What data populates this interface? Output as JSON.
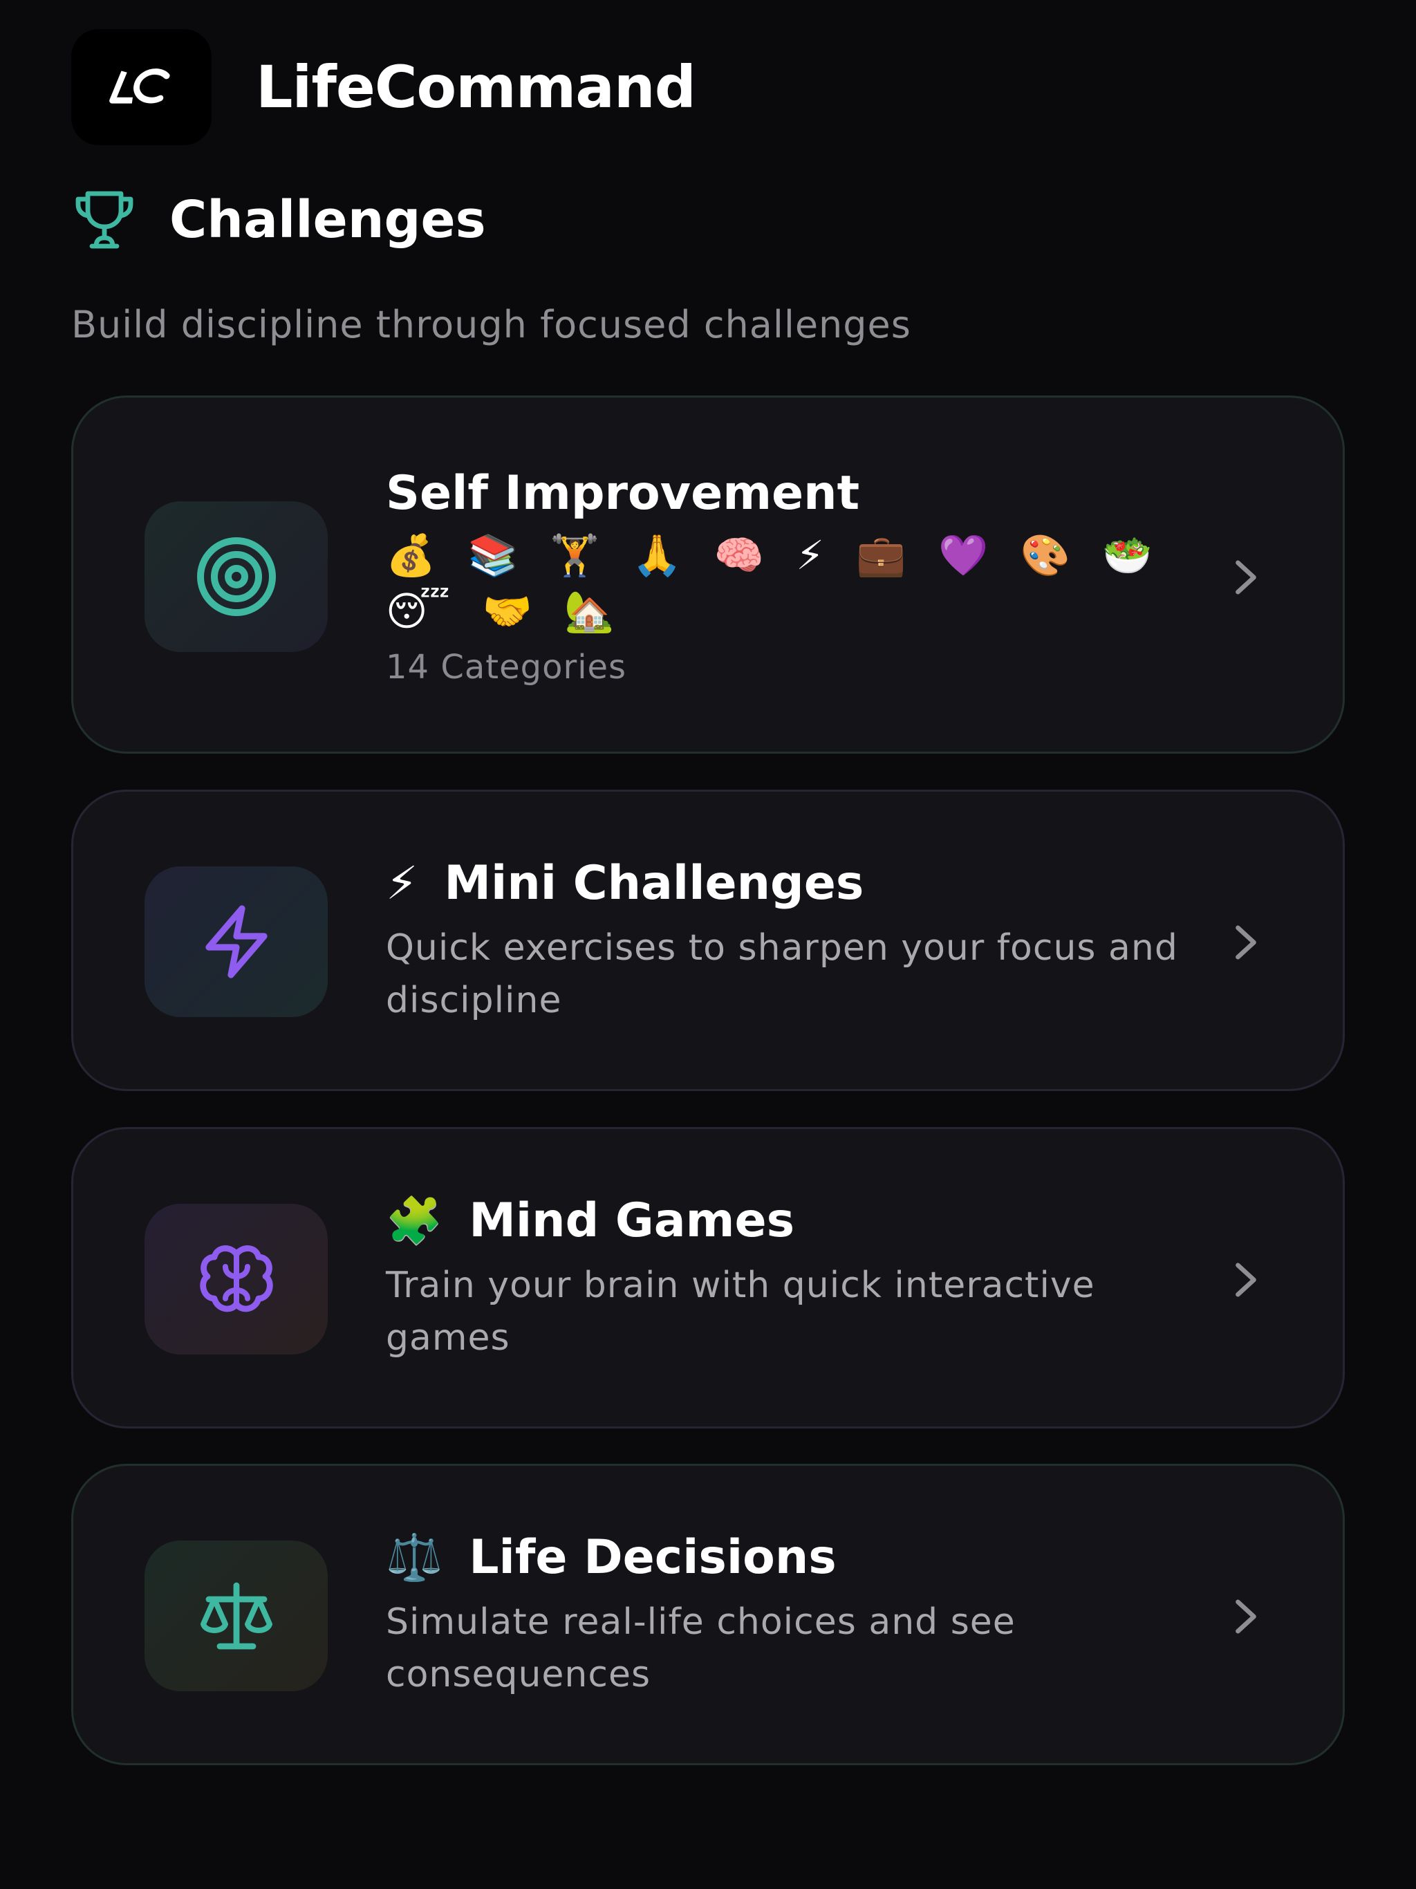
{
  "app": {
    "logo_text": "LC",
    "title": "LifeCommand"
  },
  "section": {
    "icon": "trophy-icon",
    "title": "Challenges",
    "subtitle": "Build discipline through focused challenges"
  },
  "cards": [
    {
      "icon": "target-icon",
      "title": "Self Improvement",
      "emoji_row_1": "💰 📚 🏋️ 🙏 🧠 ⚡ 💼 💜 🎨 🥗",
      "emoji_row_2": "😴 🤝 🏡",
      "meta": "14 Categories"
    },
    {
      "icon": "lightning-icon",
      "title_emoji": "⚡",
      "title": "Mini Challenges",
      "description": "Quick exercises to sharpen your focus and discipline"
    },
    {
      "icon": "brain-icon",
      "title_emoji": "🧩",
      "title": "Mind Games",
      "description": "Train your brain with quick interactive games"
    },
    {
      "icon": "scale-icon",
      "title_emoji": "⚖️",
      "title": "Life Decisions",
      "description": "Simulate real-life choices and see consequences"
    }
  ],
  "colors": {
    "background": "#0a0a0c",
    "card": "#141418",
    "teal_accent": "#3fb8a2",
    "purple_accent": "#8f5cf0",
    "muted_text": "#8e8e93"
  }
}
